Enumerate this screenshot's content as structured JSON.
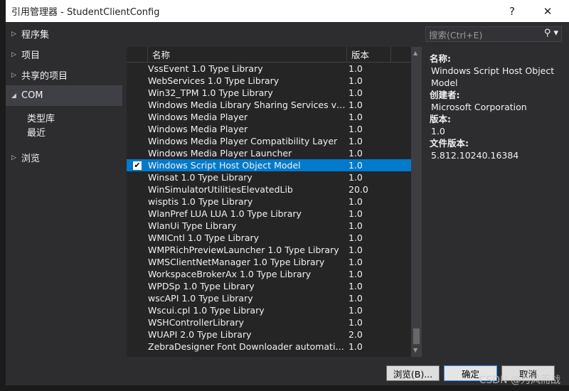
{
  "window": {
    "title": "引用管理器 - StudentClientConfig",
    "help": "?",
    "close": "✕"
  },
  "nav": {
    "items": [
      {
        "label": "程序集",
        "expanded": false
      },
      {
        "label": "项目",
        "expanded": false
      },
      {
        "label": "共享的项目",
        "expanded": false
      },
      {
        "label": "COM",
        "expanded": true,
        "selected": true
      }
    ],
    "sub": [
      "类型库",
      "最近"
    ],
    "browse": "浏览"
  },
  "search": {
    "placeholder": "搜索(Ctrl+E)"
  },
  "list": {
    "headers": {
      "name": "名称",
      "version": "版本"
    },
    "rows": [
      {
        "name": "VssEvent 1.0 Type Library",
        "version": "1.0"
      },
      {
        "name": "WebServices 1.0 Type Library",
        "version": "1.0"
      },
      {
        "name": "Win32_TPM 1.0 Type Library",
        "version": "1.0"
      },
      {
        "name": "Windows Media Library Sharing Services v1.0",
        "version": "1.0"
      },
      {
        "name": "Windows Media Player",
        "version": "1.0"
      },
      {
        "name": "Windows Media Player",
        "version": "1.0"
      },
      {
        "name": "Windows Media Player Compatibility Layer",
        "version": "1.0"
      },
      {
        "name": "Windows Media Player Launcher",
        "version": "1.0"
      },
      {
        "name": "Windows Script Host Object Model",
        "version": "1.0",
        "checked": true,
        "selected": true
      },
      {
        "name": "Winsat 1.0 Type Library",
        "version": "1.0"
      },
      {
        "name": "WinSimulatorUtilitiesElevatedLib",
        "version": "20.0"
      },
      {
        "name": "wisptis 1.0 Type Library",
        "version": "1.0"
      },
      {
        "name": "WlanPref LUA LUA 1.0 Type Library",
        "version": "1.0"
      },
      {
        "name": "WlanUi Type Library",
        "version": "1.0"
      },
      {
        "name": "WMICntl 1.0 Type Library",
        "version": "1.0"
      },
      {
        "name": "WMPRichPreviewLauncher 1.0 Type Library",
        "version": "1.0"
      },
      {
        "name": "WMSClientNetManager 1.0 Type Library",
        "version": "1.0"
      },
      {
        "name": "WorkspaceBrokerAx 1.0 Type Library",
        "version": "1.0"
      },
      {
        "name": "WPDSp 1.0 Type Library",
        "version": "1.0"
      },
      {
        "name": "wscAPI 1.0 Type Library",
        "version": "1.0"
      },
      {
        "name": "Wscui.cpl 1.0 Type Library",
        "version": "1.0"
      },
      {
        "name": "WSHControllerLibrary",
        "version": "1.0"
      },
      {
        "name": "WUAPI 2.0 Type Library",
        "version": "2.0"
      },
      {
        "name": "ZebraDesigner Font Downloader automatio...",
        "version": "1.0"
      }
    ]
  },
  "details": {
    "name_label": "名称:",
    "name": "Windows Script Host Object Model",
    "creator_label": "创建者:",
    "creator": "Microsoft Corporation",
    "version_label": "版本:",
    "version": "1.0",
    "file_version_label": "文件版本:",
    "file_version": "5.812.10240.16384"
  },
  "buttons": {
    "browse": "浏览(B)...",
    "ok": "确定",
    "cancel": "取消"
  },
  "watermark": "CSDN @为风而战",
  "colors": {
    "accent": "#007acc",
    "background": "#2d2d30"
  }
}
